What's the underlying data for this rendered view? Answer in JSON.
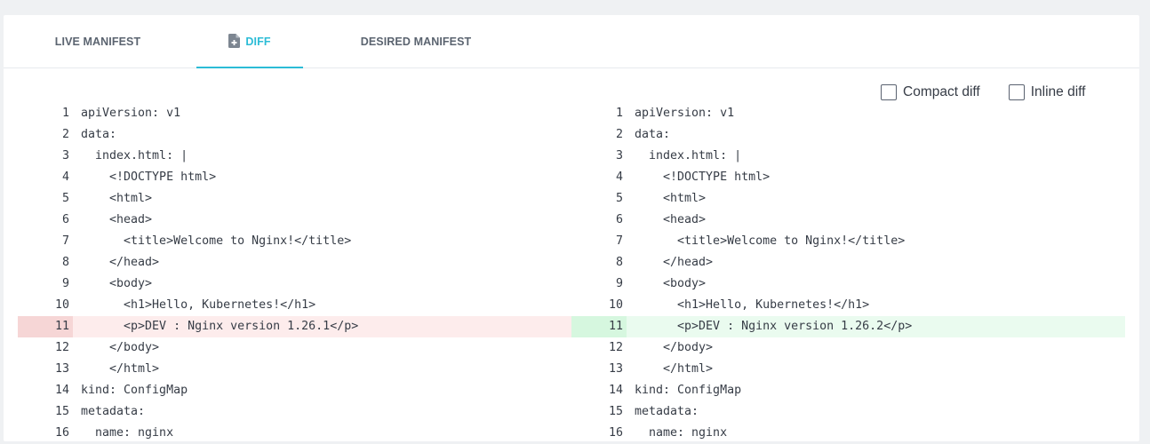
{
  "tabs": {
    "live_manifest": "LIVE MANIFEST",
    "diff": "DIFF",
    "desired_manifest": "DESIRED MANIFEST"
  },
  "options": {
    "compact_diff": "Compact diff",
    "inline_diff": "Inline diff"
  },
  "accent_color": "#2cbcd6",
  "left_lines": [
    {
      "n": "1",
      "code": "apiVersion: v1"
    },
    {
      "n": "2",
      "code": "data:"
    },
    {
      "n": "3",
      "code": "  index.html: |"
    },
    {
      "n": "4",
      "code": "    <!DOCTYPE html>"
    },
    {
      "n": "5",
      "code": "    <html>"
    },
    {
      "n": "6",
      "code": "    <head>"
    },
    {
      "n": "7",
      "code": "      <title>Welcome to Nginx!</title>"
    },
    {
      "n": "8",
      "code": "    </head>"
    },
    {
      "n": "9",
      "code": "    <body>"
    },
    {
      "n": "10",
      "code": "      <h1>Hello, Kubernetes!</h1>"
    },
    {
      "n": "11",
      "code": "      <p>DEV : Nginx version 1.26.1</p>",
      "type": "removed"
    },
    {
      "n": "12",
      "code": "    </body>"
    },
    {
      "n": "13",
      "code": "    </html>"
    },
    {
      "n": "14",
      "code": "kind: ConfigMap"
    },
    {
      "n": "15",
      "code": "metadata:"
    },
    {
      "n": "16",
      "code": "  name: nginx"
    }
  ],
  "right_lines": [
    {
      "n": "1",
      "code": "apiVersion: v1"
    },
    {
      "n": "2",
      "code": "data:"
    },
    {
      "n": "3",
      "code": "  index.html: |"
    },
    {
      "n": "4",
      "code": "    <!DOCTYPE html>"
    },
    {
      "n": "5",
      "code": "    <html>"
    },
    {
      "n": "6",
      "code": "    <head>"
    },
    {
      "n": "7",
      "code": "      <title>Welcome to Nginx!</title>"
    },
    {
      "n": "8",
      "code": "    </head>"
    },
    {
      "n": "9",
      "code": "    <body>"
    },
    {
      "n": "10",
      "code": "      <h1>Hello, Kubernetes!</h1>"
    },
    {
      "n": "11",
      "code": "      <p>DEV : Nginx version 1.26.2</p>",
      "type": "added"
    },
    {
      "n": "12",
      "code": "    </body>"
    },
    {
      "n": "13",
      "code": "    </html>"
    },
    {
      "n": "14",
      "code": "kind: ConfigMap"
    },
    {
      "n": "15",
      "code": "metadata:"
    },
    {
      "n": "16",
      "code": "  name: nginx"
    }
  ]
}
